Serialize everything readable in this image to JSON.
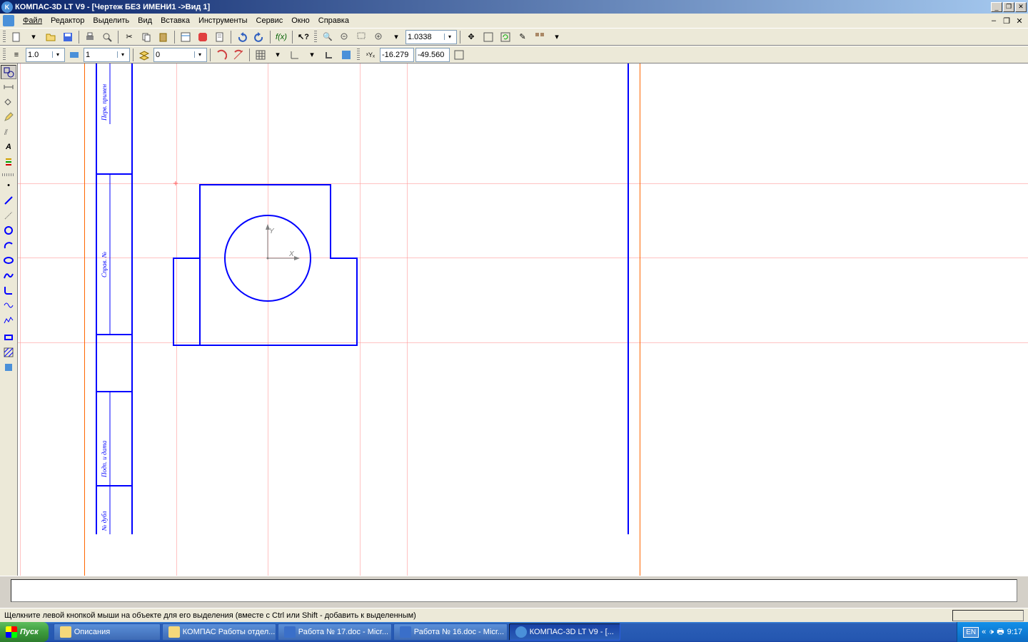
{
  "titlebar": {
    "title": "КОМПАС-3D LT V9 - [Чертеж БЕЗ ИМЕНИ1 ->Вид 1]"
  },
  "menu": {
    "items": [
      "Файл",
      "Редактор",
      "Выделить",
      "Вид",
      "Вставка",
      "Инструменты",
      "Сервис",
      "Окно",
      "Справка"
    ]
  },
  "toolbar1": {
    "zoom_value": "1.0338"
  },
  "toolbar2": {
    "line_weight": "1.0",
    "layer_value": "1",
    "style_value": "0",
    "coord_x": "-16.279",
    "coord_y": "-49.560"
  },
  "drawing_labels": {
    "l1": "Перв. примен",
    "l2": "Справ. №",
    "l3": "Подп. и дата",
    "l4": "№ дубл"
  },
  "axes": {
    "x": "X",
    "y": "Y"
  },
  "status": {
    "text": "Щелкните левой кнопкой мыши на объекте для его выделения (вместе с Ctrl или Shift - добавить к выделенным)"
  },
  "taskbar": {
    "start": "Пуск",
    "items": [
      "Описания",
      "КОМПАС Работы отдел...",
      "Работа № 17.doc - Micr...",
      "Работа № 16.doc - Micr...",
      "КОМПАС-3D LT V9 - [..."
    ],
    "lang": "EN",
    "time": "9:17"
  }
}
